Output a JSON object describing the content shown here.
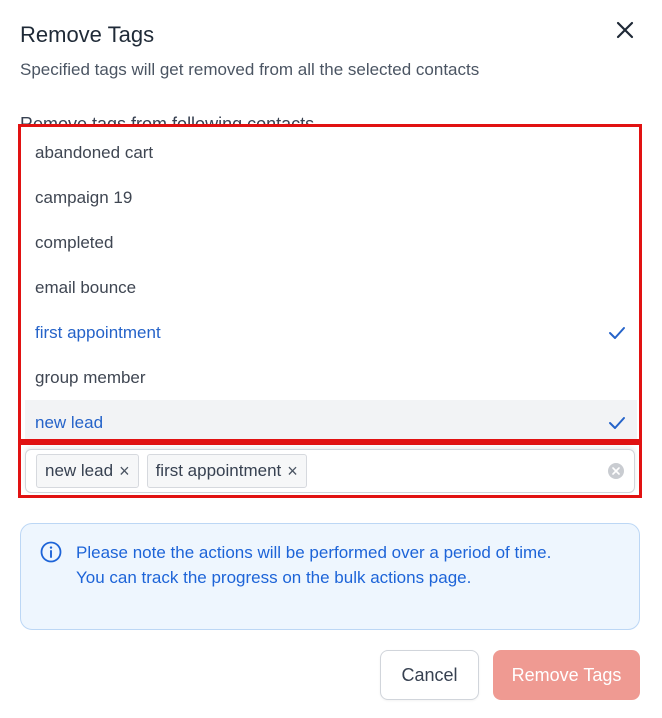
{
  "dialog": {
    "title": "Remove Tags",
    "subtitle": "Specified tags will get removed from all the selected contacts",
    "section_label": "Remove tags from following contacts",
    "close_icon": "close-icon"
  },
  "dropdown": {
    "options": [
      {
        "label": "abandoned cart",
        "selected": false
      },
      {
        "label": "campaign 19",
        "selected": false
      },
      {
        "label": "completed",
        "selected": false
      },
      {
        "label": "email bounce",
        "selected": false
      },
      {
        "label": "first appointment",
        "selected": true
      },
      {
        "label": "group member",
        "selected": false
      },
      {
        "label": "new lead",
        "selected": true,
        "hovered": true
      }
    ]
  },
  "tags": {
    "selected": [
      {
        "label": "new lead",
        "remove_glyph": "×"
      },
      {
        "label": "first appointment",
        "remove_glyph": "×"
      }
    ],
    "clear_icon": "clear-all-icon"
  },
  "notice": {
    "icon": "info-icon",
    "text": "Please note the actions will be performed over a period of time. You can track the progress on the bulk actions page."
  },
  "buttons": {
    "cancel": "Cancel",
    "remove": "Remove Tags"
  },
  "colors": {
    "accent": "#2563c9",
    "highlight_border": "#e11212",
    "remove_button": "#ef9a92",
    "notice_bg": "#eef6fe"
  }
}
